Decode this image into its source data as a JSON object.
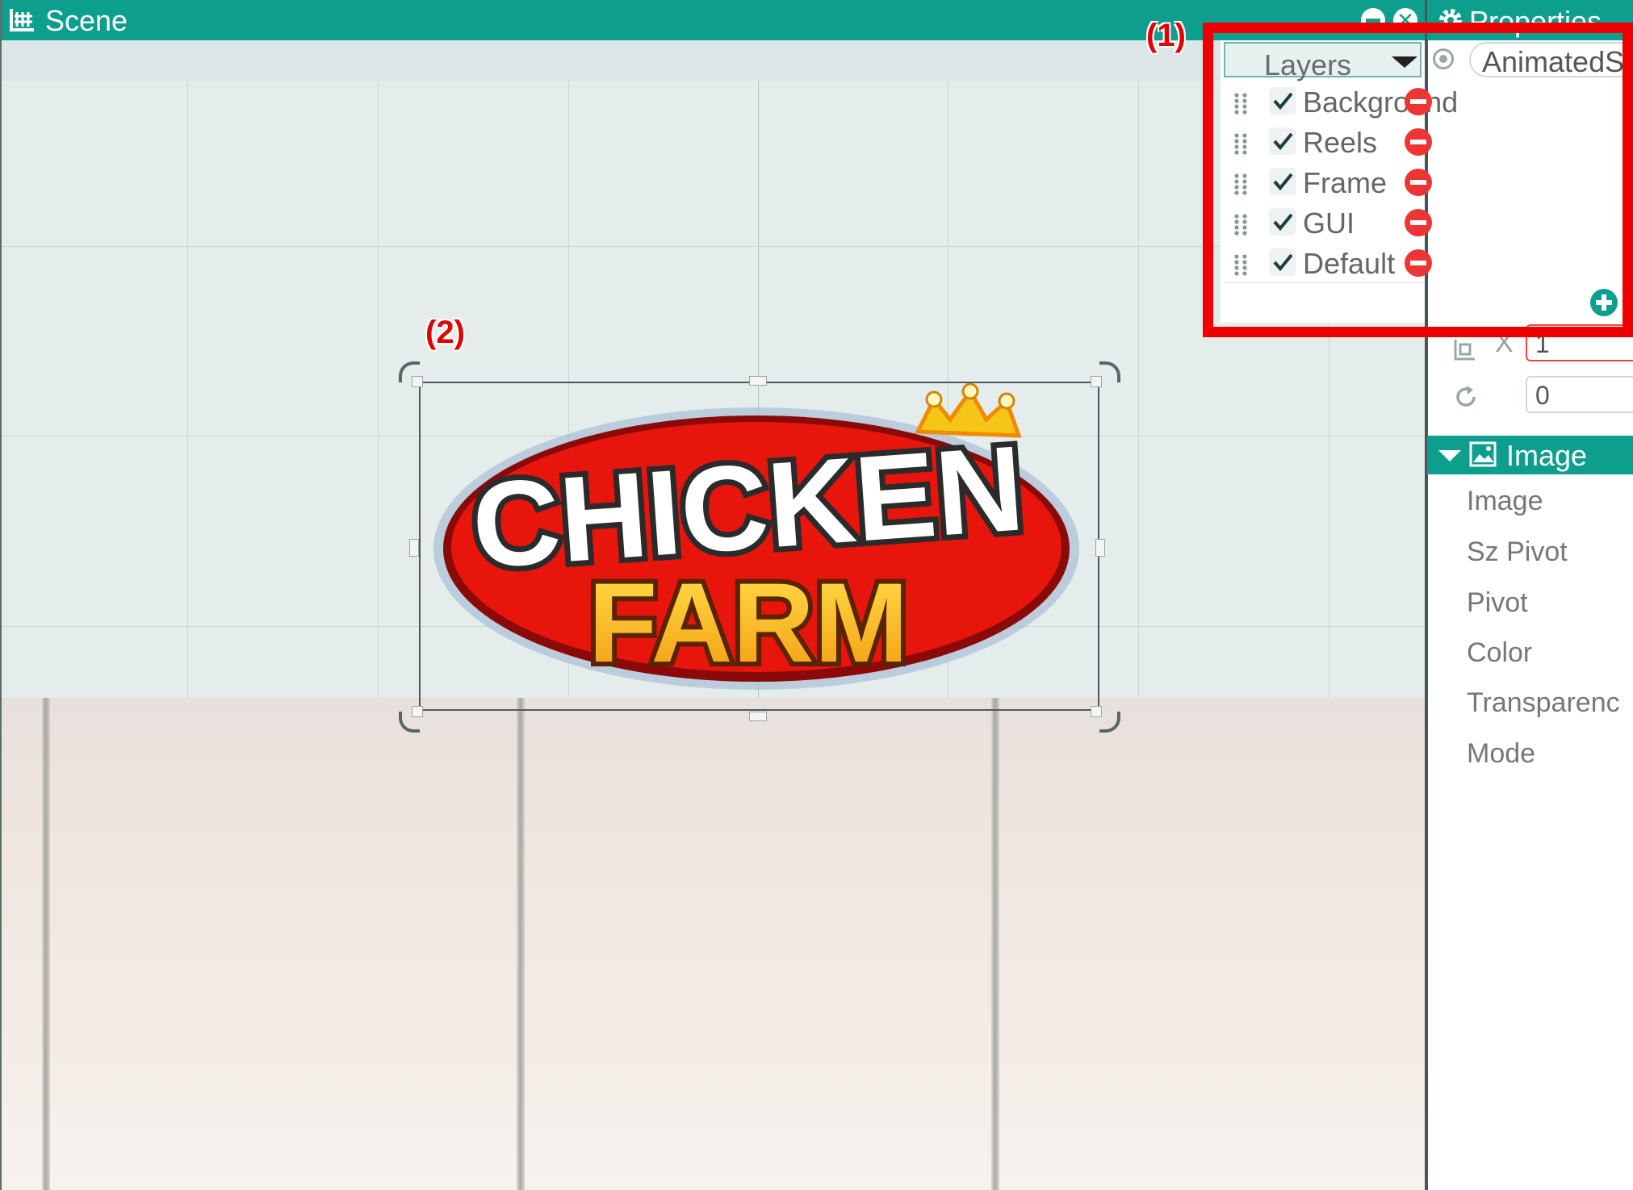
{
  "scene": {
    "title": "Scene",
    "logo_line1": "CHICKEN",
    "logo_line2": "FARM"
  },
  "annotations": {
    "callout_1": "(1)",
    "callout_2": "(2)"
  },
  "layers": {
    "dropdown_label": "Layers",
    "items": [
      {
        "name": "Background",
        "checked": true
      },
      {
        "name": "Reels",
        "checked": true
      },
      {
        "name": "Frame",
        "checked": true
      },
      {
        "name": "GUI",
        "checked": true
      },
      {
        "name": "Default",
        "checked": true
      }
    ]
  },
  "properties": {
    "title": "Properties",
    "object_type": "AnimatedS",
    "scale_x_label": "X",
    "scale_x_value": "1",
    "rotation_value": "0",
    "image_section": {
      "label": "Image",
      "fields": [
        "Image",
        "Sz Pivot",
        "Pivot",
        "Color",
        "Transparenc",
        "Mode"
      ]
    }
  },
  "colors": {
    "accent_teal": "#0e9e8e",
    "highlight_red": "#ee0000",
    "remove_red": "#ee3535"
  },
  "icons": [
    "grid-icon",
    "minimize-icon",
    "close-icon",
    "gear-icon",
    "drag-handle-icon",
    "checkbox-icon",
    "remove-icon",
    "add-icon",
    "scale-icon",
    "rotate-icon",
    "image-icon"
  ]
}
